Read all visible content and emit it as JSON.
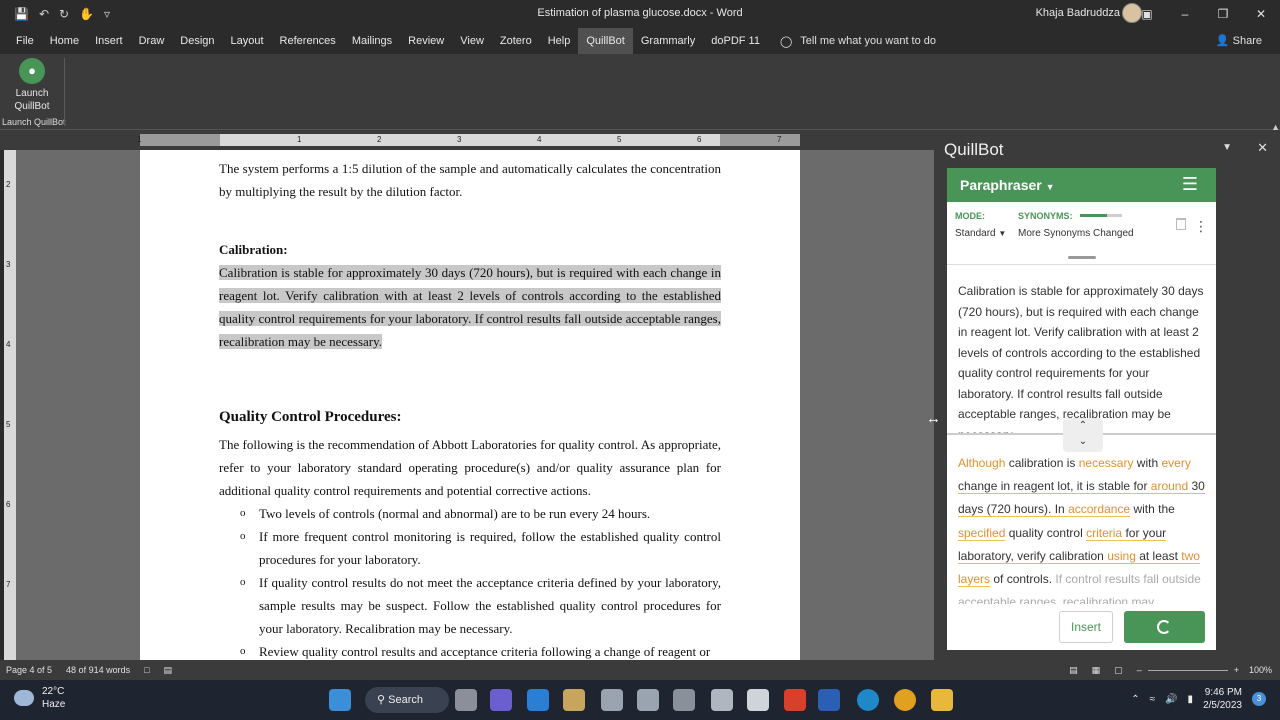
{
  "app": {
    "document_title": "Estimation of plasma glucose.docx  -  Word",
    "user_name": "Khaja Badruddza"
  },
  "menu": {
    "tabs": [
      "File",
      "Home",
      "Insert",
      "Draw",
      "Design",
      "Layout",
      "References",
      "Mailings",
      "Review",
      "View",
      "Zotero",
      "Help",
      "QuillBot",
      "Grammarly",
      "doPDF 11"
    ],
    "active_tab": "QuillBot",
    "tell_me": "Tell me what you want to do",
    "share": "Share"
  },
  "ribbon": {
    "launch_label": "Launch QuillBot",
    "group_label": "Launch QuillBot"
  },
  "ruler": {
    "numbers": [
      "1",
      "1",
      "2",
      "3",
      "4",
      "5",
      "6",
      "7"
    ],
    "vertical_numbers": [
      "2",
      "3",
      "4",
      "5",
      "6",
      "7"
    ]
  },
  "document": {
    "para1": "The system performs a 1:5 dilution of the sample and automatically calculates the concentration by multiplying the result by the dilution factor.",
    "calibration_heading": "Calibration:",
    "calibration_text": "Calibration is stable for approximately 30 days (720 hours), but is required with each change in reagent lot. Verify calibration with at least 2 levels of controls according to the established quality control requirements for your laboratory. If control results fall outside acceptable ranges, recalibration may be necessary.",
    "qc_heading": "Quality Control Procedures:",
    "qc_text": "The following is the recommendation of Abbott Laboratories for quality control. As appropriate, refer to your laboratory standard operating procedure(s) and/or quality assurance plan for additional quality control requirements and potential corrective actions.",
    "bullets": [
      "Two levels of controls (normal and abnormal) are to be run every 24 hours.",
      "If more frequent control monitoring is required, follow the established quality control procedures for your laboratory.",
      "If quality control results do not meet the acceptance criteria defined by your laboratory, sample results may be suspect. Follow the established quality control procedures for your laboratory. Recalibration may be necessary.",
      "Review quality control results and acceptance criteria following a change of reagent or"
    ],
    "bullet_marker": "o"
  },
  "status": {
    "page": "Page 4 of 5",
    "words": "48 of 914 words",
    "zoom": "100%"
  },
  "quillbot": {
    "panel_title": "QuillBot",
    "tool": "Paraphraser",
    "mode_label": "MODE:",
    "mode_value": "Standard",
    "synonyms_label": "SYNONYMS:",
    "synonyms_value": "More Synonyms Changed",
    "synonyms_level": 0.65,
    "input_text": "Calibration is stable for approximately 30 days (720 hours), but is required with each change in reagent lot. Verify calibration with at least 2 levels of controls according to the established quality control requirements for your laboratory. If control results fall outside acceptable ranges, recalibration may be necessary.",
    "output_segments": [
      {
        "t": "Although",
        "k": "chg"
      },
      {
        "t": " calibration is ",
        "k": ""
      },
      {
        "t": "necessary",
        "k": "chg"
      },
      {
        "t": " with ",
        "k": ""
      },
      {
        "t": "every",
        "k": "chg"
      },
      {
        "t": " change in reagent lot, it is stable for ",
        "k": "ul"
      },
      {
        "t": "around",
        "k": "chg ul"
      },
      {
        "t": " 30 days (720 hours). In ",
        "k": "ul"
      },
      {
        "t": "accordance",
        "k": "chg ul"
      },
      {
        "t": " with the ",
        "k": ""
      },
      {
        "t": "specified",
        "k": "chg ul"
      },
      {
        "t": " quality control ",
        "k": ""
      },
      {
        "t": "criteria",
        "k": "chg ul"
      },
      {
        "t": " for your laboratory, verify calibration ",
        "k": "ul"
      },
      {
        "t": "using",
        "k": "chg ul"
      },
      {
        "t": " at least ",
        "k": "ul"
      },
      {
        "t": "two layers",
        "k": "chg ul"
      },
      {
        "t": " of controls. ",
        "k": ""
      },
      {
        "t": "If control results fall outside acceptable ranges, recalibration may",
        "k": "faded"
      }
    ],
    "insert_label": "Insert"
  },
  "taskbar": {
    "temp": "22°C",
    "weather": "Haze",
    "search": "Search",
    "time": "9:46 PM",
    "date": "2/5/2023",
    "notifications": "3"
  }
}
